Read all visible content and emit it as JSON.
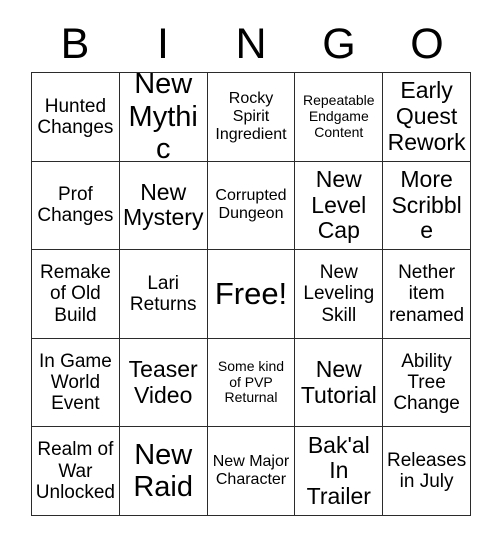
{
  "card": {
    "title_letters": [
      "B",
      "I",
      "N",
      "G",
      "O"
    ],
    "grid_size": 5,
    "free_space_label": "Free!",
    "rows": [
      [
        {
          "text": "Hunted Changes",
          "size": "md"
        },
        {
          "text": "New Mythic",
          "size": "xl"
        },
        {
          "text": "Rocky Spirit Ingredient",
          "size": "sm"
        },
        {
          "text": "Repeatable Endgame Content",
          "size": "xs"
        },
        {
          "text": "Early Quest Rework",
          "size": "lg"
        }
      ],
      [
        {
          "text": "Prof Changes",
          "size": "md"
        },
        {
          "text": "New Mystery",
          "size": "lg"
        },
        {
          "text": "Corrupted Dungeon",
          "size": "sm"
        },
        {
          "text": "New Level Cap",
          "size": "lg"
        },
        {
          "text": "More Scribble",
          "size": "lg"
        }
      ],
      [
        {
          "text": "Remake of Old Build",
          "size": "md"
        },
        {
          "text": "Lari Returns",
          "size": "md"
        },
        {
          "text": "Free!",
          "size": "free"
        },
        {
          "text": "New Leveling Skill",
          "size": "md"
        },
        {
          "text": "Nether item renamed",
          "size": "md"
        }
      ],
      [
        {
          "text": "In Game World Event",
          "size": "md"
        },
        {
          "text": "Teaser Video",
          "size": "lg"
        },
        {
          "text": "Some kind of PVP Returnal",
          "size": "xs"
        },
        {
          "text": "New Tutorial",
          "size": "lg"
        },
        {
          "text": "Ability Tree Change",
          "size": "md"
        }
      ],
      [
        {
          "text": "Realm of War Unlocked",
          "size": "md"
        },
        {
          "text": "New Raid",
          "size": "xl"
        },
        {
          "text": "New Major Character",
          "size": "sm"
        },
        {
          "text": "Bak'al In Trailer",
          "size": "lg"
        },
        {
          "text": "Releases in July",
          "size": "md"
        }
      ]
    ]
  },
  "colors": {
    "background": "#ffffff",
    "grid_line": "#2b2b2b",
    "text": "#000000"
  }
}
